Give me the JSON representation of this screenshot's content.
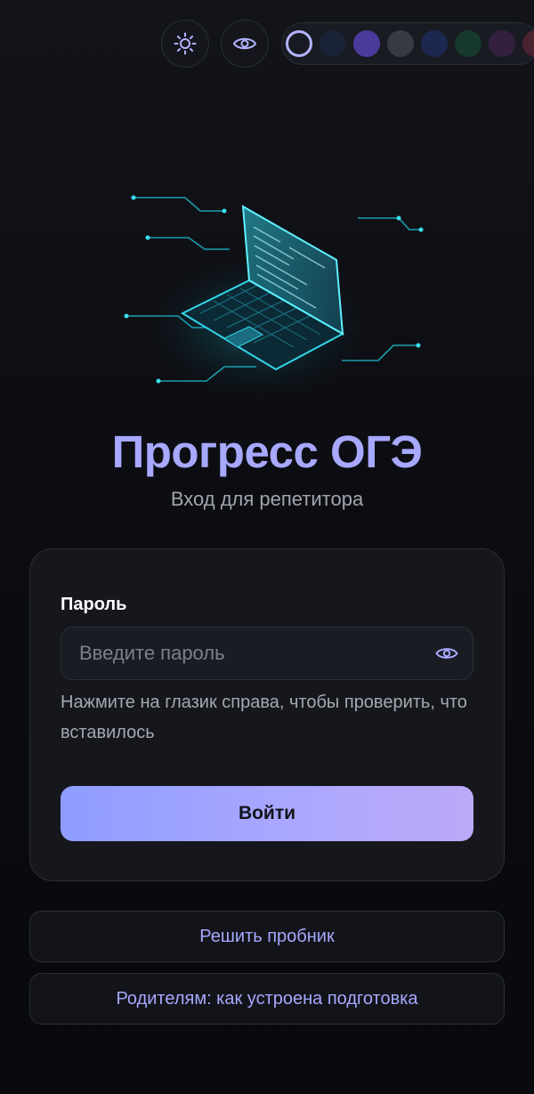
{
  "toolbar": {
    "theme_icon": "sun-icon",
    "visibility_icon": "eye-icon",
    "swatches": [
      {
        "color": "transparent",
        "selected": true
      },
      {
        "color": "#1a2236"
      },
      {
        "color": "#4a3a9c"
      },
      {
        "color": "#353a43"
      },
      {
        "color": "#1c2850"
      },
      {
        "color": "#17382c"
      },
      {
        "color": "#33203f"
      },
      {
        "color": "#4a2230"
      }
    ]
  },
  "hero": {
    "title": "Прогресс ОГЭ",
    "subtitle": "Вход для репетитора"
  },
  "login": {
    "password_label": "Пароль",
    "password_placeholder": "Введите пароль",
    "password_value": "",
    "toggle_icon": "eye-icon",
    "hint": "Нажмите на глазик справа, чтобы проверить, что вставилось",
    "submit_label": "Войти"
  },
  "links": {
    "trial": "Решить пробник",
    "parents": "Родителям: как устроена подготовка"
  },
  "colors": {
    "accent": "#a7a8ff",
    "background": "#0c0d12",
    "card": "#15171d",
    "button_gradient_start": "#8f9dff",
    "button_gradient_end": "#bca9f8"
  }
}
